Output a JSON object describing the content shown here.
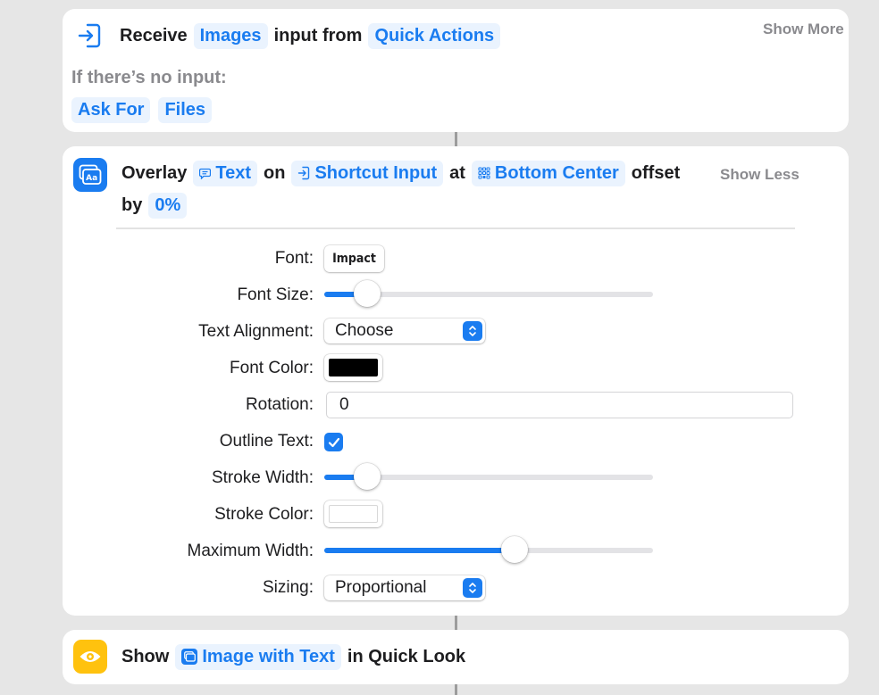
{
  "colors": {
    "accent": "#1a7cf0",
    "token_bg": "#eaf3fe",
    "secondary_text": "#8a8a8e",
    "quicklook_yellow": "#ffc20e"
  },
  "receive_action": {
    "icon": "receive-input-icon",
    "word_receive": "Receive",
    "token_images": "Images",
    "word_input_from": "input from",
    "token_source": "Quick Actions",
    "show_more": "Show More",
    "no_input_label": "If there’s no input:",
    "token_ask_for": "Ask For",
    "token_files": "Files"
  },
  "overlay_action": {
    "icon": "overlay-text-app-icon",
    "app_icon_text": "Aa",
    "word_overlay": "Overlay",
    "token_text": "Text",
    "word_on": "on",
    "token_input": "Shortcut Input",
    "word_at": "at",
    "token_position": "Bottom Center",
    "word_offset": "offset",
    "word_by": "by",
    "token_offset": "0%",
    "show_less": "Show Less",
    "params": {
      "font": {
        "label": "Font:",
        "value": "Impact"
      },
      "font_size": {
        "label": "Font Size:",
        "level": 0.13
      },
      "text_alignment": {
        "label": "Text Alignment:",
        "value": "Choose"
      },
      "font_color": {
        "label": "Font Color:",
        "color": "#000000"
      },
      "rotation": {
        "label": "Rotation:",
        "value": "0"
      },
      "outline_text": {
        "label": "Outline Text:",
        "checked": true
      },
      "stroke_width": {
        "label": "Stroke Width:",
        "level": 0.13
      },
      "stroke_color": {
        "label": "Stroke Color:",
        "color": "#ffffff"
      },
      "maximum_width": {
        "label": "Maximum Width:",
        "level": 0.58
      },
      "sizing": {
        "label": "Sizing:",
        "value": "Proportional"
      }
    }
  },
  "show_action": {
    "icon": "quick-look-eye-icon",
    "word_show": "Show",
    "token_image": "Image with Text",
    "word_in_quick_look": "in Quick Look"
  }
}
